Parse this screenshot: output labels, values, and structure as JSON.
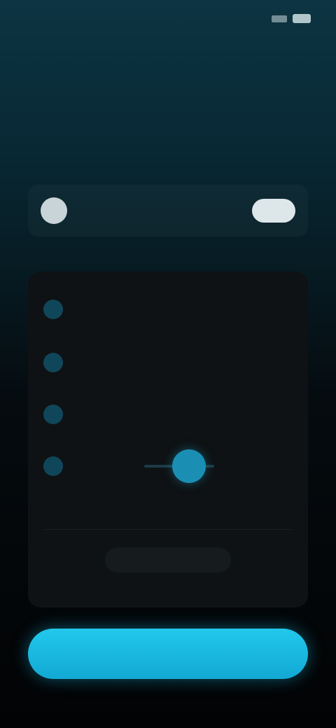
{
  "status_bar": {
    "time": "",
    "icons": [
      "signal-icon",
      "battery-icon"
    ]
  },
  "header": {
    "back_label": "",
    "title": "",
    "subtitle": ""
  },
  "summary": {
    "label": ""
  },
  "list": {
    "rows": [
      {
        "label": "",
        "value": "",
        "icon": "circle-icon"
      },
      {
        "label": "",
        "value": "",
        "icon": "circle-icon"
      },
      {
        "label": "",
        "value": "",
        "icon": "circle-icon"
      },
      {
        "label": "",
        "value": "",
        "icon": "circle-icon"
      }
    ],
    "more_label": ""
  },
  "footer": {
    "primary_label": ""
  },
  "colors": {
    "accent": "#1fbde6",
    "background_top": "#0c3442",
    "background_bottom": "#020304",
    "card": "#0e1214"
  }
}
